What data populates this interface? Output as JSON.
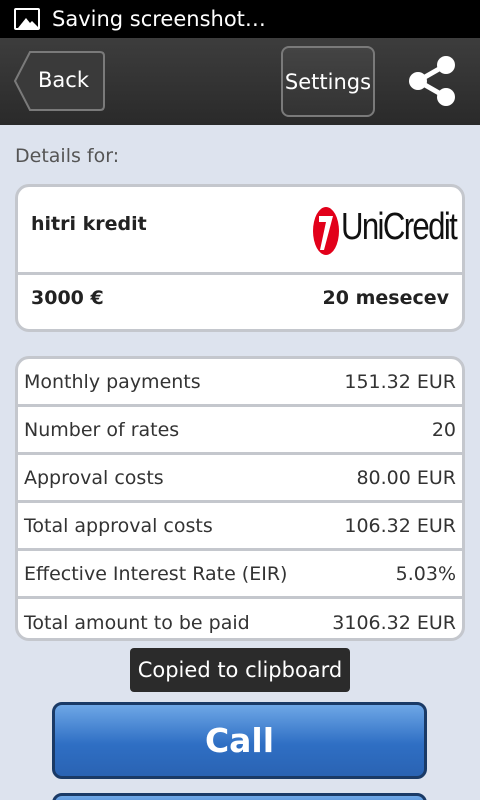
{
  "status_bar": {
    "notification_text": "Saving screenshot…"
  },
  "toolbar": {
    "back_label": "Back",
    "settings_label": "Settings"
  },
  "details_label": "Details for:",
  "loan_card": {
    "product_name": "hitri kredit",
    "bank_logo_text": "UniCredit",
    "amount": "3000 €",
    "period": "20 mesecev"
  },
  "details": {
    "rows": [
      {
        "label": "Monthly payments",
        "value": "151.32 EUR"
      },
      {
        "label": "Number of rates",
        "value": "20"
      },
      {
        "label": "Approval costs",
        "value": "80.00 EUR"
      },
      {
        "label": "Total approval costs",
        "value": "106.32 EUR"
      },
      {
        "label": "Effective Interest Rate (EIR)",
        "value": "5.03%"
      },
      {
        "label": "Total amount to be paid",
        "value": "3106.32 EUR"
      }
    ]
  },
  "toast": "Copied to clipboard",
  "call_button_label": "Call",
  "colors": {
    "accent_blue": "#2f6fc4",
    "logo_red": "#e2001a",
    "toolbar": "#333333"
  },
  "icons": [
    "image-icon",
    "share-icon",
    "unicredit-logo"
  ]
}
